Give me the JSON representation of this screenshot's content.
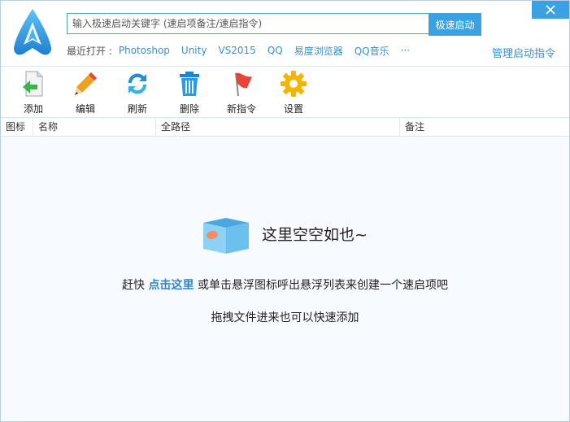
{
  "search": {
    "placeholder": "输入极速启动关键字 (速启项备注/速启指令)",
    "button_label": "极速启动"
  },
  "recent": {
    "label": "最近打开 :",
    "items": [
      "Photoshop",
      "Unity",
      "VS2015",
      "QQ",
      "易度浏览器",
      "QQ音乐",
      "···"
    ]
  },
  "manage_link": "管理启动指令",
  "toolbar": {
    "items": [
      {
        "label": "添加",
        "icon": "add-file-icon"
      },
      {
        "label": "编辑",
        "icon": "pencil-icon"
      },
      {
        "label": "刷新",
        "icon": "refresh-icon"
      },
      {
        "label": "删除",
        "icon": "trash-icon"
      },
      {
        "label": "新指令",
        "icon": "flag-icon"
      },
      {
        "label": "设置",
        "icon": "gear-icon"
      }
    ]
  },
  "table": {
    "columns": [
      "图标",
      "名称",
      "全路径",
      "备注"
    ]
  },
  "empty": {
    "title": "这里空空如也~",
    "line1_prefix": "赶快 ",
    "line1_link": "点击这里",
    "line1_suffix": " 或单击悬浮图标呼出悬浮列表来创建一个速启项吧",
    "line2": "拖拽文件进来也可以快速添加"
  },
  "colors": {
    "accent": "#3aa2e2",
    "link": "#3a8fce",
    "background": "#f7fbff"
  }
}
